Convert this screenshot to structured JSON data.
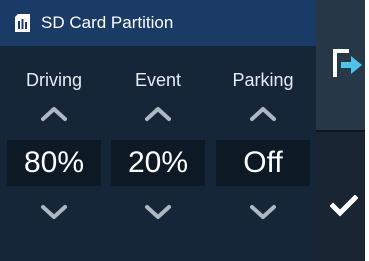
{
  "header": {
    "title": "SD Card Partition",
    "icon": "sd-card-icon"
  },
  "columns": [
    {
      "label": "Driving",
      "value": "80%"
    },
    {
      "label": "Event",
      "value": "20%"
    },
    {
      "label": "Parking",
      "value": "Off"
    }
  ],
  "side": {
    "exit_icon": "exit-arrow-icon",
    "confirm_icon": "checkmark-icon"
  },
  "colors": {
    "header_bg": "#1a3b66",
    "panel_bg": "#142638",
    "value_bg": "#0d1925",
    "accent_icon": "#4fc3e8",
    "text": "#ffffff"
  }
}
